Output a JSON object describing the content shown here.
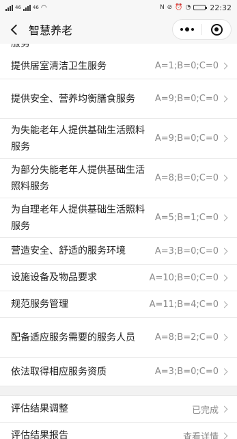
{
  "status_bar": {
    "sim1": "46",
    "sim2": "46",
    "time": "22:32"
  },
  "nav": {
    "title": "智慧养老"
  },
  "partial_text": "服务",
  "items": [
    {
      "label": "提供居室清洁卫生服务",
      "value": "A=1;B=0;C=0"
    },
    {
      "label": "提供安全、营养均衡膳食服务",
      "value": "A=9;B=0;C=0"
    },
    {
      "label": "为失能老年人提供基础生活照料服务",
      "value": "A=9;B=0;C=0"
    },
    {
      "label": "为部分失能老年人提供基础生活照料服务",
      "value": "A=8;B=0;C=0"
    },
    {
      "label": "为自理老年人提供基础生活照料服务",
      "value": "A=5;B=1;C=0"
    },
    {
      "label": "营造安全、舒适的服务环境",
      "value": "A=3;B=0;C=0"
    },
    {
      "label": "设施设备及物品要求",
      "value": "A=10;B=0;C=0"
    },
    {
      "label": "规范服务管理",
      "value": "A=11;B=4;C=0"
    },
    {
      "label": "配备适应服务需要的服务人员",
      "value": "A=8;B=2;C=0"
    },
    {
      "label": "依法取得相应服务资质",
      "value": "A=3;B=0;C=0"
    }
  ],
  "footer_items": [
    {
      "label": "评估结果调整",
      "value": "已完成"
    },
    {
      "label": "评估结果报告",
      "value": "查看详情"
    }
  ]
}
